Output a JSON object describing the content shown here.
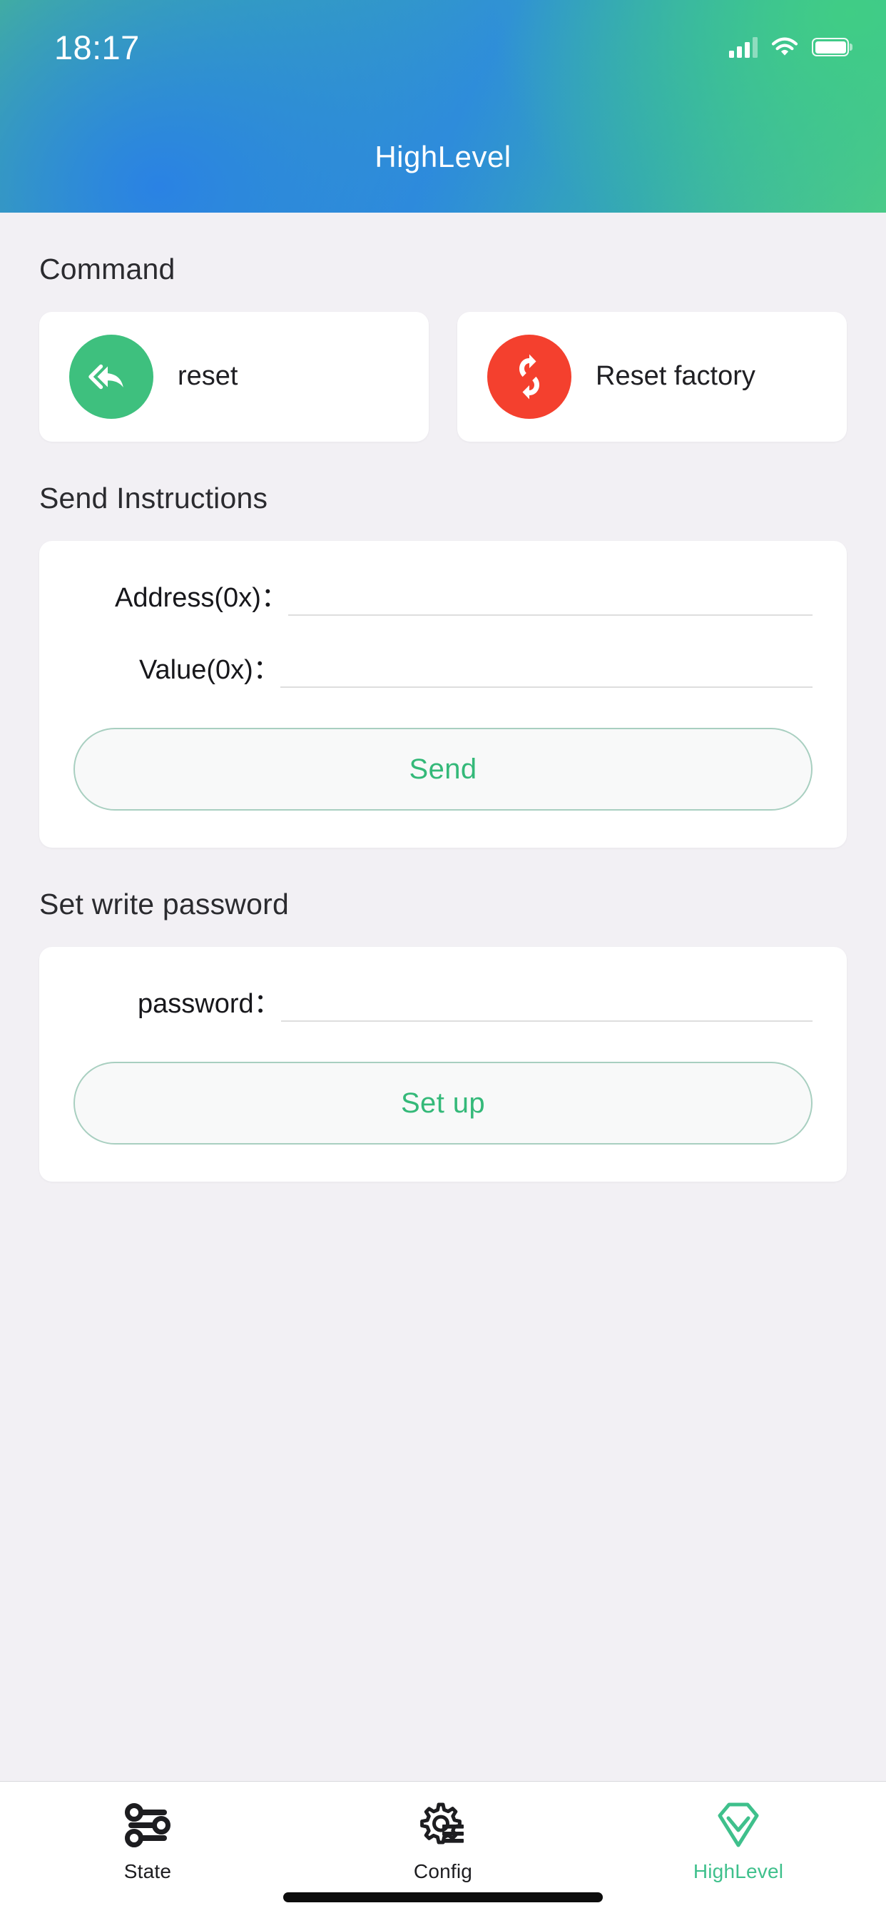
{
  "status_bar": {
    "time": "18:17",
    "signal_icon": "cellular-signal-icon",
    "signal_bars_filled": 3,
    "signal_bars_total": 4,
    "wifi_icon": "wifi-icon",
    "battery_icon": "battery-full-icon",
    "battery_level": 100
  },
  "header": {
    "title": "HighLevel",
    "gradient_from": "#4bbf86",
    "gradient_mid": "#2f8fd8",
    "gradient_to": "#4ec98a",
    "title_color": "#ffffff"
  },
  "command_section": {
    "title": "Command",
    "buttons": [
      {
        "label": "reset",
        "icon": "reply-all-back-arrows-icon",
        "icon_color": "#3ec07e"
      },
      {
        "label": "Reset factory",
        "icon": "refresh-sync-icon",
        "icon_color": "#f4402e"
      }
    ]
  },
  "send_instructions": {
    "title": "Send Instructions",
    "fields": [
      {
        "label": "Address(0x)：",
        "value": "",
        "placeholder": ""
      },
      {
        "label": "Value(0x)：",
        "value": "",
        "placeholder": ""
      }
    ],
    "submit_label": "Send"
  },
  "set_password": {
    "title": "Set write password",
    "fields": [
      {
        "label": "password：",
        "value": "",
        "placeholder": ""
      }
    ],
    "submit_label": "Set up"
  },
  "tab_bar": {
    "active_color": "#3fc08c",
    "inactive_color": "#1d1d20",
    "tabs": [
      {
        "label": "State",
        "icon": "sliders-icon",
        "active": false
      },
      {
        "label": "Config",
        "icon": "gear-list-icon",
        "active": false
      },
      {
        "label": "HighLevel",
        "icon": "diamond-check-icon",
        "active": true
      }
    ]
  }
}
